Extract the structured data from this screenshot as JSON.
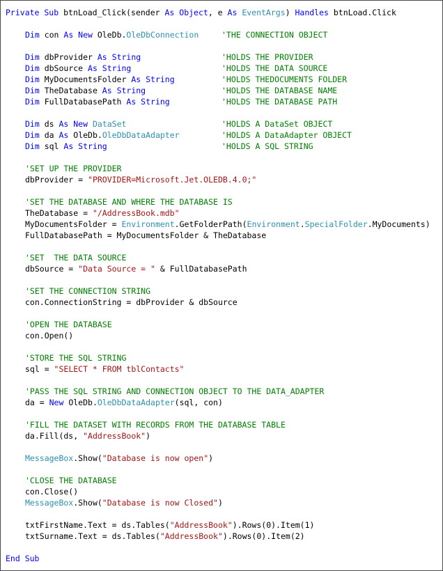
{
  "colors": {
    "keyword": "#0000ff",
    "type": "#2b91af",
    "string": "#a31515",
    "comment": "#008000",
    "plain": "#000000",
    "background": "#ffffff",
    "border": "#4a4a4a"
  },
  "lines": [
    {
      "indent": 0,
      "segments": [
        {
          "kind": "kw",
          "text": "Private Sub"
        },
        {
          "kind": "plain",
          "text": " btnLoad_Click(sender "
        },
        {
          "kind": "kw",
          "text": "As Object"
        },
        {
          "kind": "plain",
          "text": ", e "
        },
        {
          "kind": "kw",
          "text": "As"
        },
        {
          "kind": "plain",
          "text": " "
        },
        {
          "kind": "type",
          "text": "EventArgs"
        },
        {
          "kind": "plain",
          "text": ") "
        },
        {
          "kind": "kw",
          "text": "Handles"
        },
        {
          "kind": "plain",
          "text": " btnLoad.Click"
        }
      ]
    },
    {
      "indent": 0,
      "segments": []
    },
    {
      "indent": 1,
      "segments": [
        {
          "kind": "kw",
          "text": "Dim"
        },
        {
          "kind": "plain",
          "text": " con "
        },
        {
          "kind": "kw",
          "text": "As New"
        },
        {
          "kind": "plain",
          "text": " OleDb."
        },
        {
          "kind": "type",
          "text": "OleDbConnection"
        }
      ],
      "comment": "'THE CONNECTION OBJECT"
    },
    {
      "indent": 0,
      "segments": []
    },
    {
      "indent": 1,
      "segments": [
        {
          "kind": "kw",
          "text": "Dim"
        },
        {
          "kind": "plain",
          "text": " dbProvider "
        },
        {
          "kind": "kw",
          "text": "As String"
        }
      ],
      "comment": "'HOLDS THE PROVIDER"
    },
    {
      "indent": 1,
      "segments": [
        {
          "kind": "kw",
          "text": "Dim"
        },
        {
          "kind": "plain",
          "text": " dbSource "
        },
        {
          "kind": "kw",
          "text": "As String"
        }
      ],
      "comment": "'HOLDS THE DATA SOURCE"
    },
    {
      "indent": 1,
      "segments": [
        {
          "kind": "kw",
          "text": "Dim"
        },
        {
          "kind": "plain",
          "text": " MyDocumentsFolder "
        },
        {
          "kind": "kw",
          "text": "As String"
        }
      ],
      "comment": "'HOLDS THEDOCUMENTS FOLDER"
    },
    {
      "indent": 1,
      "segments": [
        {
          "kind": "kw",
          "text": "Dim"
        },
        {
          "kind": "plain",
          "text": " TheDatabase "
        },
        {
          "kind": "kw",
          "text": "As String"
        }
      ],
      "comment": "'HOLDS THE DATABASE NAME"
    },
    {
      "indent": 1,
      "segments": [
        {
          "kind": "kw",
          "text": "Dim"
        },
        {
          "kind": "plain",
          "text": " FullDatabasePath "
        },
        {
          "kind": "kw",
          "text": "As String"
        }
      ],
      "comment": "'HOLDS THE DATABASE PATH"
    },
    {
      "indent": 0,
      "segments": []
    },
    {
      "indent": 1,
      "segments": [
        {
          "kind": "kw",
          "text": "Dim"
        },
        {
          "kind": "plain",
          "text": " ds "
        },
        {
          "kind": "kw",
          "text": "As New"
        },
        {
          "kind": "plain",
          "text": " "
        },
        {
          "kind": "type",
          "text": "DataSet"
        }
      ],
      "comment": "'HOLDS A DataSet OBJECT"
    },
    {
      "indent": 1,
      "segments": [
        {
          "kind": "kw",
          "text": "Dim"
        },
        {
          "kind": "plain",
          "text": " da "
        },
        {
          "kind": "kw",
          "text": "As"
        },
        {
          "kind": "plain",
          "text": " OleDb."
        },
        {
          "kind": "type",
          "text": "OleDbDataAdapter"
        }
      ],
      "comment": "'HOLDS A DataAdapter OBJECT"
    },
    {
      "indent": 1,
      "segments": [
        {
          "kind": "kw",
          "text": "Dim"
        },
        {
          "kind": "plain",
          "text": " sql "
        },
        {
          "kind": "kw",
          "text": "As String"
        }
      ],
      "comment": "'HOLDS A SQL STRING"
    },
    {
      "indent": 0,
      "segments": []
    },
    {
      "indent": 1,
      "segments": [
        {
          "kind": "cmt",
          "text": "'SET UP THE PROVIDER"
        }
      ]
    },
    {
      "indent": 1,
      "segments": [
        {
          "kind": "plain",
          "text": "dbProvider = "
        },
        {
          "kind": "str",
          "text": "\"PROVIDER=Microsoft.Jet.OLEDB.4.0;\""
        }
      ]
    },
    {
      "indent": 0,
      "segments": []
    },
    {
      "indent": 1,
      "segments": [
        {
          "kind": "cmt",
          "text": "'SET THE DATABASE AND WHERE THE DATABASE IS"
        }
      ]
    },
    {
      "indent": 1,
      "segments": [
        {
          "kind": "plain",
          "text": "TheDatabase = "
        },
        {
          "kind": "str",
          "text": "\"/AddressBook.mdb\""
        }
      ]
    },
    {
      "indent": 1,
      "segments": [
        {
          "kind": "plain",
          "text": "MyDocumentsFolder = "
        },
        {
          "kind": "type",
          "text": "Environment"
        },
        {
          "kind": "plain",
          "text": ".GetFolderPath("
        },
        {
          "kind": "type",
          "text": "Environment"
        },
        {
          "kind": "plain",
          "text": "."
        },
        {
          "kind": "type",
          "text": "SpecialFolder"
        },
        {
          "kind": "plain",
          "text": ".MyDocuments)"
        }
      ]
    },
    {
      "indent": 1,
      "segments": [
        {
          "kind": "plain",
          "text": "FullDatabasePath = MyDocumentsFolder & TheDatabase"
        }
      ]
    },
    {
      "indent": 0,
      "segments": []
    },
    {
      "indent": 1,
      "segments": [
        {
          "kind": "cmt",
          "text": "'SET  THE DATA SOURCE"
        }
      ]
    },
    {
      "indent": 1,
      "segments": [
        {
          "kind": "plain",
          "text": "dbSource = "
        },
        {
          "kind": "str",
          "text": "\"Data Source = \""
        },
        {
          "kind": "plain",
          "text": " & FullDatabasePath"
        }
      ]
    },
    {
      "indent": 0,
      "segments": []
    },
    {
      "indent": 1,
      "segments": [
        {
          "kind": "cmt",
          "text": "'SET THE CONNECTION STRING"
        }
      ]
    },
    {
      "indent": 1,
      "segments": [
        {
          "kind": "plain",
          "text": "con.ConnectionString = dbProvider & dbSource"
        }
      ]
    },
    {
      "indent": 0,
      "segments": []
    },
    {
      "indent": 1,
      "segments": [
        {
          "kind": "cmt",
          "text": "'OPEN THE DATABASE"
        }
      ]
    },
    {
      "indent": 1,
      "segments": [
        {
          "kind": "plain",
          "text": "con.Open()"
        }
      ]
    },
    {
      "indent": 0,
      "segments": []
    },
    {
      "indent": 1,
      "segments": [
        {
          "kind": "cmt",
          "text": "'STORE THE SQL STRING"
        }
      ]
    },
    {
      "indent": 1,
      "segments": [
        {
          "kind": "plain",
          "text": "sql = "
        },
        {
          "kind": "str",
          "text": "\"SELECT * FROM tblContacts\""
        }
      ]
    },
    {
      "indent": 0,
      "segments": []
    },
    {
      "indent": 1,
      "segments": [
        {
          "kind": "cmt",
          "text": "'PASS THE SQL STRING AND CONNECTION OBJECT TO THE DATA_ADAPTER"
        }
      ]
    },
    {
      "indent": 1,
      "segments": [
        {
          "kind": "plain",
          "text": "da = "
        },
        {
          "kind": "kw",
          "text": "New"
        },
        {
          "kind": "plain",
          "text": " OleDb."
        },
        {
          "kind": "type",
          "text": "OleDbDataAdapter"
        },
        {
          "kind": "plain",
          "text": "(sql, con)"
        }
      ]
    },
    {
      "indent": 0,
      "segments": []
    },
    {
      "indent": 1,
      "segments": [
        {
          "kind": "cmt",
          "text": "'FILL THE DATASET WITH RECORDS FROM THE DATABASE TABLE"
        }
      ]
    },
    {
      "indent": 1,
      "segments": [
        {
          "kind": "plain",
          "text": "da.Fill(ds, "
        },
        {
          "kind": "str",
          "text": "\"AddressBook\""
        },
        {
          "kind": "plain",
          "text": ")"
        }
      ]
    },
    {
      "indent": 0,
      "segments": []
    },
    {
      "indent": 1,
      "segments": [
        {
          "kind": "type",
          "text": "MessageBox"
        },
        {
          "kind": "plain",
          "text": ".Show("
        },
        {
          "kind": "str",
          "text": "\"Database is now open\""
        },
        {
          "kind": "plain",
          "text": ")"
        }
      ]
    },
    {
      "indent": 0,
      "segments": []
    },
    {
      "indent": 1,
      "segments": [
        {
          "kind": "cmt",
          "text": "'CLOSE THE DATABASE"
        }
      ]
    },
    {
      "indent": 1,
      "segments": [
        {
          "kind": "plain",
          "text": "con.Close()"
        }
      ]
    },
    {
      "indent": 1,
      "segments": [
        {
          "kind": "type",
          "text": "MessageBox"
        },
        {
          "kind": "plain",
          "text": ".Show("
        },
        {
          "kind": "str",
          "text": "\"Database is now Closed\""
        },
        {
          "kind": "plain",
          "text": ")"
        }
      ]
    },
    {
      "indent": 0,
      "segments": []
    },
    {
      "indent": 1,
      "segments": [
        {
          "kind": "plain",
          "text": "txtFirstName.Text = ds.Tables("
        },
        {
          "kind": "str",
          "text": "\"AddressBook\""
        },
        {
          "kind": "plain",
          "text": ").Rows(0).Item(1)"
        }
      ]
    },
    {
      "indent": 1,
      "segments": [
        {
          "kind": "plain",
          "text": "txtSurname.Text = ds.Tables("
        },
        {
          "kind": "str",
          "text": "\"AddressBook\""
        },
        {
          "kind": "plain",
          "text": ").Rows(0).Item(2)"
        }
      ]
    },
    {
      "indent": 0,
      "segments": []
    },
    {
      "indent": 0,
      "segments": [
        {
          "kind": "kw",
          "text": "End Sub"
        }
      ]
    }
  ]
}
